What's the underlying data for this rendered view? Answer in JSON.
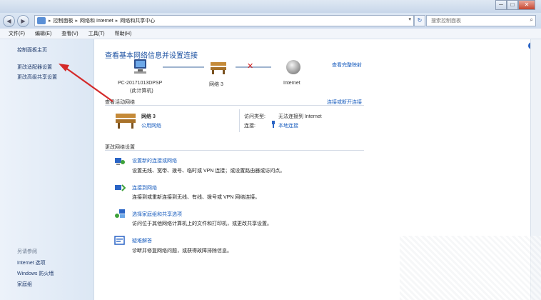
{
  "window": {
    "minimize_label": "─",
    "maximize_label": "□",
    "close_label": "✕"
  },
  "address": {
    "back_label": "◀",
    "forward_label": "▶",
    "crumbs": [
      "控制面板",
      "网络和 Internet",
      "网络和共享中心"
    ],
    "separator": "▸",
    "dropdown_label": "▾",
    "refresh_label": "↻",
    "search_placeholder": "搜索控制面板",
    "search_icon_label": "⌕"
  },
  "menu": {
    "items": [
      "文件(F)",
      "编辑(E)",
      "查看(V)",
      "工具(T)",
      "帮助(H)"
    ]
  },
  "sidebar": {
    "home": "控制面板主页",
    "links": [
      "更改适配器设置",
      "更改高级共享设置"
    ],
    "see_also_heading": "另请参阅",
    "see_also": [
      "Internet 选项",
      "Windows 防火墙",
      "家庭组"
    ]
  },
  "main": {
    "help_label": "?",
    "title": "查看基本网络信息并设置连接",
    "view_full_map": "查看完整映射",
    "map": {
      "computer_name": "PC-20171013DPSP",
      "computer_sub": "(此计算机)",
      "network_name": "网络 3",
      "internet_label": "Internet",
      "cross": "✕"
    },
    "active_networks_title": "查看活动网络",
    "connect_disconnect": "连接或断开连接",
    "active_network": {
      "name": "网络 3",
      "type": "公用网络",
      "access_type_label": "访问类型:",
      "access_type_value": "无法连接到 Internet",
      "connections_label": "连接:",
      "connections_value": "本地连接"
    },
    "change_settings_title": "更改网络设置",
    "tasks": [
      {
        "title": "设置新的连接或网络",
        "desc": "设置无线、宽带、拨号、临时或 VPN 连接；或设置路由器或访问点。"
      },
      {
        "title": "连接到网络",
        "desc": "连接到或重新连接到无线、有线、拨号或 VPN 网络连接。"
      },
      {
        "title": "选择家庭组和共享选项",
        "desc": "访问位于其他网络计算机上的文件和打印机，或更改共享设置。"
      },
      {
        "title": "疑难解答",
        "desc": "诊断并修复网络问题，或获得故障排除信息。"
      }
    ]
  },
  "colors": {
    "link": "#1c5fbf",
    "title": "#1a4fa0",
    "annotation_arrow": "#d42a2a"
  }
}
